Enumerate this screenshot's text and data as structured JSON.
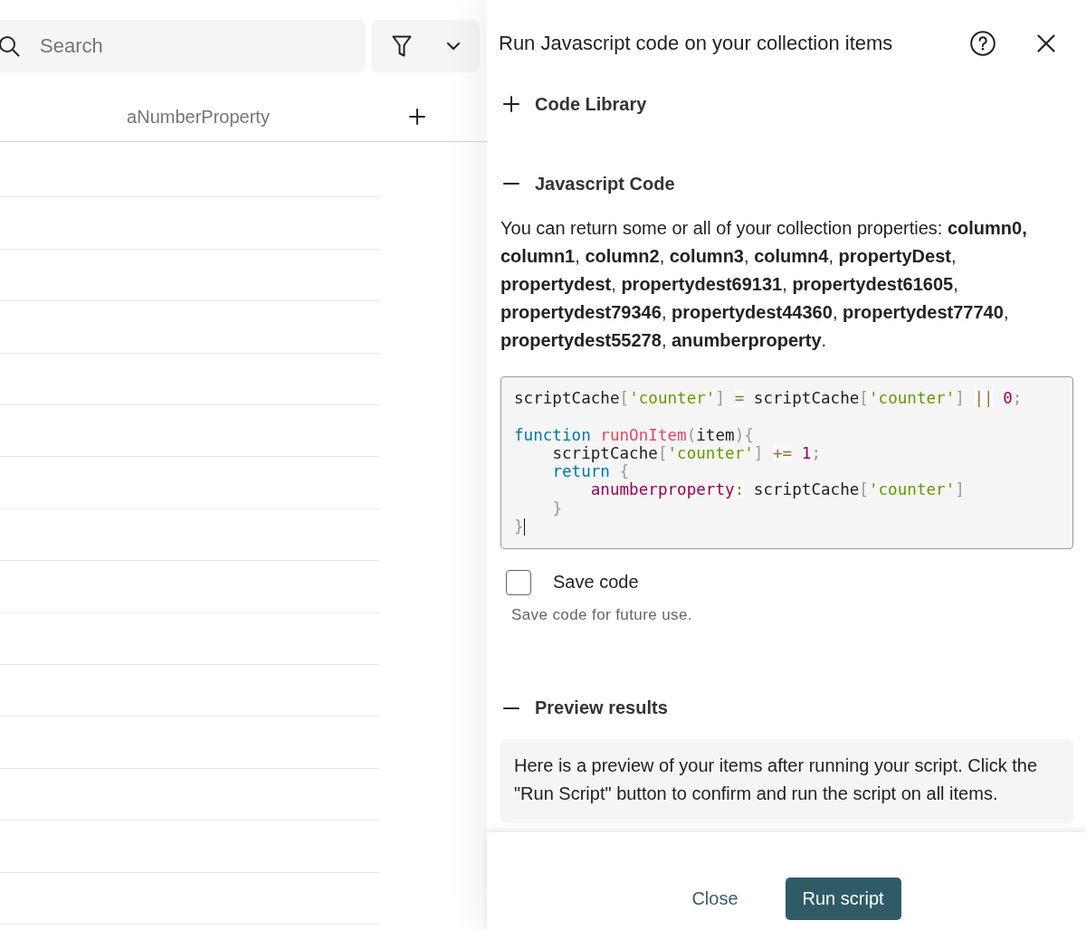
{
  "search": {
    "placeholder": "Search"
  },
  "table": {
    "columns": [
      {
        "label": "aNumberProperty"
      }
    ]
  },
  "panel": {
    "title": "Run Javascript code on your collection items",
    "sections": [
      {
        "kind": "library",
        "title": "Code Library",
        "expanded": false
      },
      {
        "kind": "code",
        "title": "Javascript Code",
        "expanded": true,
        "description": "You can return some or all of your collection properties: **column0,** **column1**, **column2**, **column3**, **column4**, **propertyDest**, **propertydest**, **propertydest69131**, **propertydest61605**, **propertydest79346**, **propertydest44360**, **propertydest77740**, **propertydest55278**, **anumberproperty**.",
        "code_lines": [
          {
            "tokens": [
              {
                "kind": "plain",
                "text": "scriptCache"
              },
              {
                "kind": "punctuation",
                "text": "["
              },
              {
                "kind": "string",
                "text": "'counter'"
              },
              {
                "kind": "punctuation",
                "text": "] "
              },
              {
                "kind": "operator",
                "text": "="
              },
              {
                "kind": "plain",
                "text": " scriptCache"
              },
              {
                "kind": "punctuation",
                "text": "["
              },
              {
                "kind": "string",
                "text": "'counter'"
              },
              {
                "kind": "punctuation",
                "text": "] "
              },
              {
                "kind": "operator",
                "text": "||"
              },
              {
                "kind": "number",
                "text": " 0"
              },
              {
                "kind": "punctuation",
                "text": ";"
              }
            ]
          },
          {
            "gap_before": true,
            "tokens": [
              {
                "kind": "keyword",
                "text": "function "
              },
              {
                "kind": "function",
                "text": "runOnItem"
              },
              {
                "kind": "punctuation",
                "text": "("
              },
              {
                "kind": "plain",
                "text": "item"
              },
              {
                "kind": "punctuation",
                "text": "){"
              }
            ]
          },
          {
            "tokens": [
              {
                "kind": "plain",
                "text": "    scriptCache"
              },
              {
                "kind": "punctuation",
                "text": "["
              },
              {
                "kind": "string",
                "text": "'counter'"
              },
              {
                "kind": "punctuation",
                "text": "] "
              },
              {
                "kind": "operator",
                "text": "+="
              },
              {
                "kind": "number",
                "text": " 1"
              },
              {
                "kind": "punctuation",
                "text": ";"
              }
            ]
          },
          {
            "tokens": [
              {
                "kind": "keyword",
                "text": "    return"
              },
              {
                "kind": "punctuation",
                "text": " {"
              }
            ]
          },
          {
            "tokens": [
              {
                "kind": "property",
                "text": "        anumberproperty"
              },
              {
                "kind": "operator",
                "text": ":"
              },
              {
                "kind": "plain",
                "text": " scriptCache"
              },
              {
                "kind": "punctuation",
                "text": "["
              },
              {
                "kind": "string",
                "text": "'counter'"
              },
              {
                "kind": "punctuation",
                "text": "]"
              }
            ]
          },
          {
            "tokens": [
              {
                "kind": "punctuation",
                "text": "    }"
              }
            ]
          },
          {
            "cursor": true,
            "tokens": [
              {
                "kind": "punctuation",
                "text": "}"
              }
            ]
          }
        ],
        "save": {
          "label": "Save code",
          "checked": false,
          "hint": "Save code for future use."
        }
      },
      {
        "kind": "preview",
        "title": "Preview results",
        "expanded": true,
        "message": "Here is a preview of your items after running your script. Click the \"Run Script\" button to confirm and run the script on all items."
      }
    ],
    "buttons": [
      {
        "kind": "text",
        "label": "Close"
      },
      {
        "kind": "primary",
        "label": "Run script"
      }
    ]
  }
}
